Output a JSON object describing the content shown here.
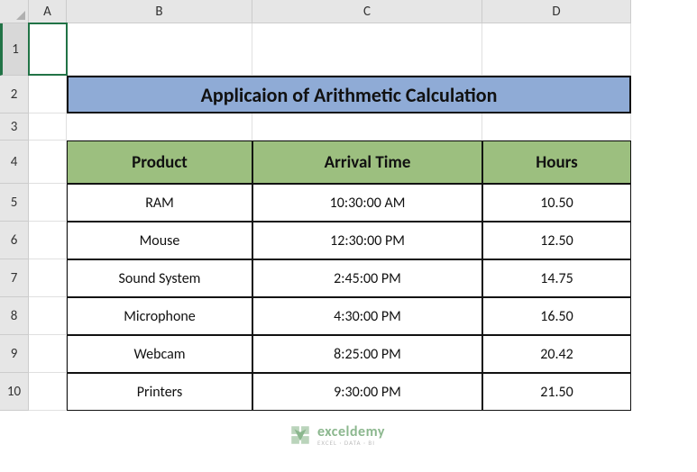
{
  "columns": [
    "A",
    "B",
    "C",
    "D"
  ],
  "rows": [
    "1",
    "2",
    "3",
    "4",
    "5",
    "6",
    "7",
    "8",
    "9",
    "10"
  ],
  "title": "Applicaion of Arithmetic Calculation",
  "table": {
    "headers": {
      "product": "Product",
      "arrival": "Arrival Time",
      "hours": "Hours"
    },
    "rows": [
      {
        "product": "RAM",
        "arrival": "10:30:00 AM",
        "hours": "10.50"
      },
      {
        "product": "Mouse",
        "arrival": "12:30:00 PM",
        "hours": "12.50"
      },
      {
        "product": "Sound System",
        "arrival": "2:45:00 PM",
        "hours": "14.75"
      },
      {
        "product": "Microphone",
        "arrival": "4:30:00 PM",
        "hours": "16.50"
      },
      {
        "product": "Webcam",
        "arrival": "8:25:00 PM",
        "hours": "20.42"
      },
      {
        "product": "Printers",
        "arrival": "9:30:00 PM",
        "hours": "21.50"
      }
    ]
  },
  "watermark": {
    "name": "exceldemy",
    "tagline": "EXCEL · DATA · BI"
  },
  "chart_data": {
    "type": "table",
    "title": "Applicaion of Arithmetic Calculation",
    "columns": [
      "Product",
      "Arrival Time",
      "Hours"
    ],
    "rows": [
      [
        "RAM",
        "10:30:00 AM",
        10.5
      ],
      [
        "Mouse",
        "12:30:00 PM",
        12.5
      ],
      [
        "Sound System",
        "2:45:00 PM",
        14.75
      ],
      [
        "Microphone",
        "4:30:00 PM",
        16.5
      ],
      [
        "Webcam",
        "8:25:00 PM",
        20.42
      ],
      [
        "Printers",
        "9:30:00 PM",
        21.5
      ]
    ]
  }
}
